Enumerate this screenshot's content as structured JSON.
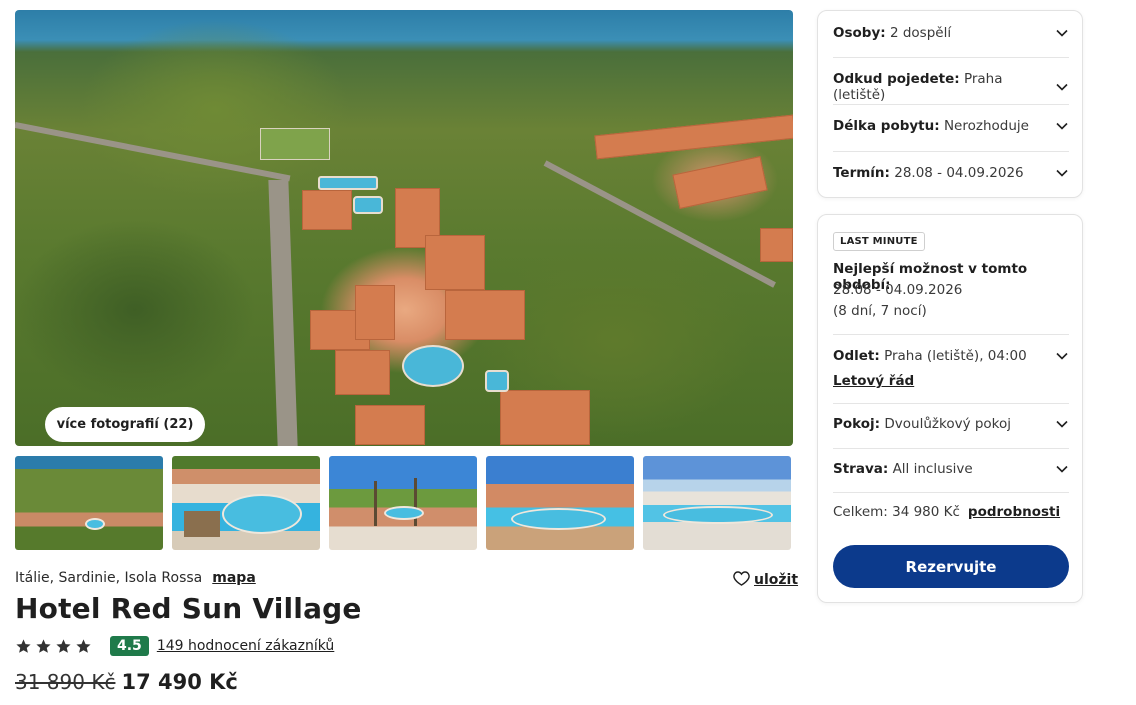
{
  "gallery": {
    "more_photos_label": "více fotografií (22)",
    "thumbnails": [
      "thumb-1",
      "thumb-2",
      "thumb-3",
      "thumb-4",
      "thumb-5"
    ]
  },
  "hotel": {
    "location": "Itálie, Sardinie, Isola Rossa",
    "map_link": "mapa",
    "save_label": "uložit",
    "name": "Hotel Red Sun Village",
    "stars": 4,
    "score": "4.5",
    "reviews_label": "149 hodnocení zákazníků",
    "old_price": "31 890 Kč",
    "new_price": "17 490 Kč"
  },
  "filters": {
    "persons_label": "Osoby:",
    "persons_value": "2 dospělí",
    "departure_label": "Odkud pojedete:",
    "departure_value": "Praha (letiště)",
    "length_label": "Délka pobytu:",
    "length_value": "Nerozhoduje",
    "term_label": "Termín:",
    "term_value": "28.08 - 04.09.2026"
  },
  "offer": {
    "badge": "LAST MINUTE",
    "best_title": "Nejlepší možnost v tomto období:",
    "best_dates": "28.08 - 04.09.2026",
    "best_length": "(8 dní, 7 nocí)",
    "flight_label": "Odlet:",
    "flight_value": "Praha (letiště), 04:00",
    "flight_link": "Letový řád",
    "room_label": "Pokoj:",
    "room_value": "Dvoulůžkový pokoj",
    "board_label": "Strava:",
    "board_value": "All inclusive",
    "total_label": "Celkem: 34 980 Kč",
    "details_link": "podrobnosti",
    "reserve_label": "Rezervujte"
  },
  "colors": {
    "primary_button": "#0c3a8c",
    "score_badge": "#1f7a4a"
  }
}
